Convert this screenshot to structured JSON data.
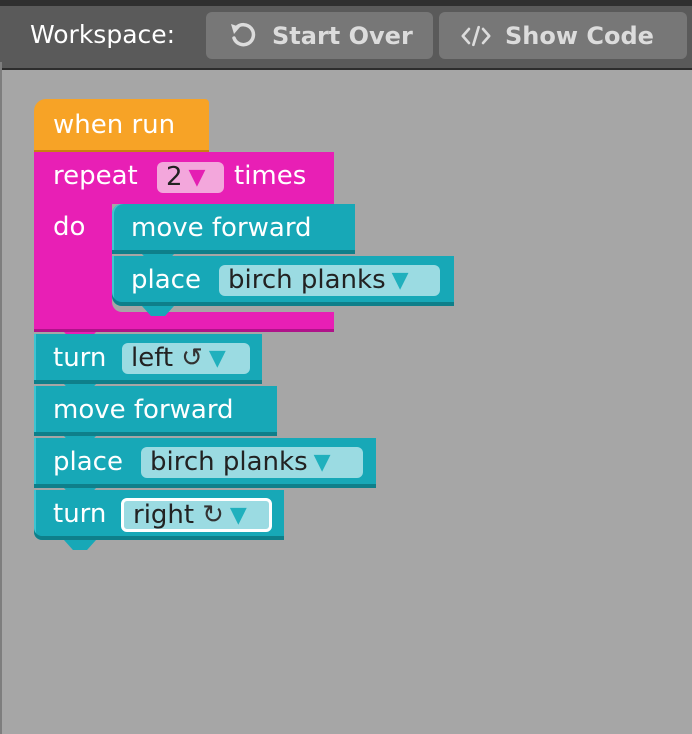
{
  "toolbar": {
    "workspace_label": "Workspace:",
    "start_over_label": "Start Over",
    "show_code_label": "Show Code",
    "start_over_icon": "undo-icon",
    "show_code_icon": "code-icon"
  },
  "colors": {
    "event": "#f7a326",
    "loop": "#e81fb5",
    "action": "#17a8b7",
    "workspace": "#a6a6a6"
  },
  "blocks": {
    "when_run": "when run",
    "repeat": {
      "label": "repeat",
      "count": "2",
      "suffix": "times",
      "do_label": "do"
    },
    "inner_move": "move forward",
    "inner_place": {
      "label": "place",
      "value": "birch planks"
    },
    "turn_left": {
      "label": "turn",
      "value": "left"
    },
    "move_forward": "move forward",
    "place": {
      "label": "place",
      "value": "birch planks"
    },
    "turn_right": {
      "label": "turn",
      "value": "right"
    }
  }
}
